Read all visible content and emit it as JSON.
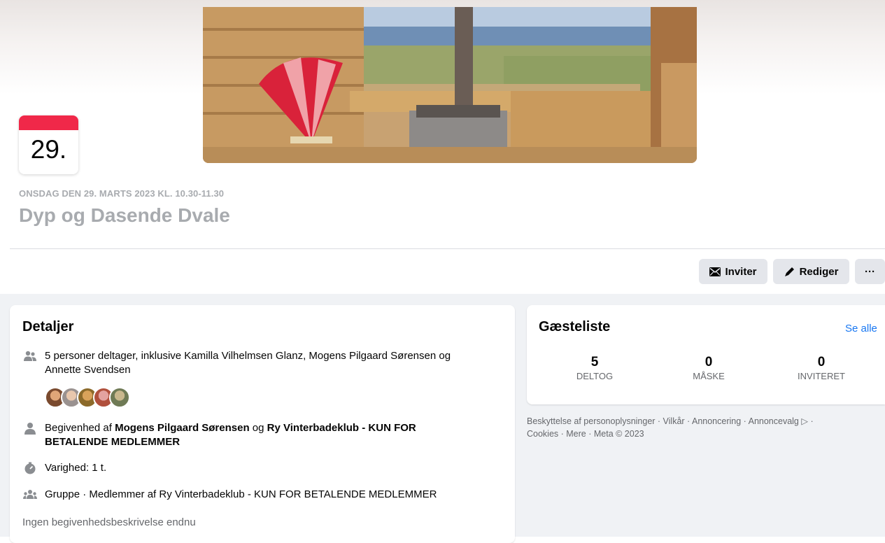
{
  "event": {
    "day": "29.",
    "date_line": "ONSDAG DEN 29. MARTS 2023 KL. 10.30-11.30",
    "title": "Dyp og Dasende Dvale"
  },
  "actions": {
    "invite": "Inviter",
    "edit": "Rediger",
    "more": "···"
  },
  "details": {
    "heading": "Detaljer",
    "attendees_line1": "5 personer deltager, inklusive Kamilla Vilhelmsen Glanz, Mogens Pilgaard Sørensen og",
    "attendees_line2": "Annette Svendsen",
    "host_prefix": "Begivenhed af ",
    "host_name": "Mogens Pilgaard Sørensen",
    "host_join": " og ",
    "host_group_line1": "Ry Vinterbadeklub - KUN FOR",
    "host_group_line2": "BETALENDE MEDLEMMER",
    "duration": "Varighed: 1 t.",
    "group_line": "Gruppe · Medlemmer af Ry Vinterbadeklub - KUN FOR BETALENDE MEDLEMMER",
    "no_description": "Ingen begivenhedsbeskrivelse endnu"
  },
  "guests": {
    "heading": "Gæsteliste",
    "see_all": "Se alle",
    "stats": [
      {
        "num": "5",
        "label": "DELTOG"
      },
      {
        "num": "0",
        "label": "MÅSKE"
      },
      {
        "num": "0",
        "label": "INVITERET"
      }
    ]
  },
  "footer": {
    "line1": "Beskyttelse af personoplysninger · Vilkår · Annoncering · Annoncevalg ▷ ·",
    "line2": "Cookies · Mere · Meta © 2023"
  },
  "colors": {
    "accent_red": "#f02849",
    "link_blue": "#1877f2",
    "muted_text": "#65676b",
    "button_bg": "#e4e6eb"
  },
  "icons": [
    "people-icon",
    "person-icon",
    "stopwatch-icon",
    "group-icon",
    "envelope-icon",
    "pencil-icon"
  ]
}
